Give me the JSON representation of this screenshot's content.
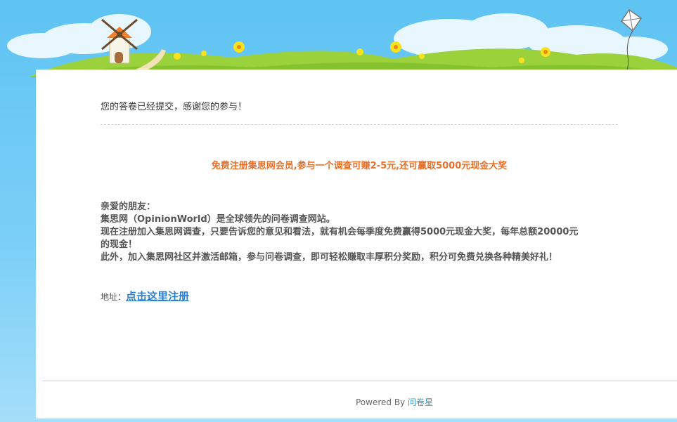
{
  "confirmation": {
    "message": "您的答卷已经提交，感谢您的参与！"
  },
  "promo": {
    "headline": "免费注册集思网会员,参与一个调查可赚2-5元,还可赢取5000元现金大奖",
    "color": "#e8702a"
  },
  "letter": {
    "greeting": "亲爱的朋友：",
    "line1": "集思网（OpinionWorld）是全球领先的问卷调查网站。",
    "line2": "现在注册加入集思网调查，只要告诉您的意见和看法，就有机会每季度免费赢得5000元现金大奖，每年总额20000元",
    "line3": "的现金！",
    "line4": "此外，加入集思网社区并激活邮箱，参与问卷调查，即可轻松赚取丰厚积分奖励，积分可免费兑换各种精美好礼！"
  },
  "address": {
    "label": "地址：",
    "link_text": "点击这里注册"
  },
  "footer": {
    "powered_by": "Powered By",
    "brand_link": "问卷星"
  },
  "colors": {
    "sky": "#5ec3f3",
    "grass": "#9bd23c",
    "link": "#2a7fd4"
  },
  "icons": [
    "windmill-icon",
    "kite-icon",
    "flower-icon",
    "cloud-icon"
  ]
}
